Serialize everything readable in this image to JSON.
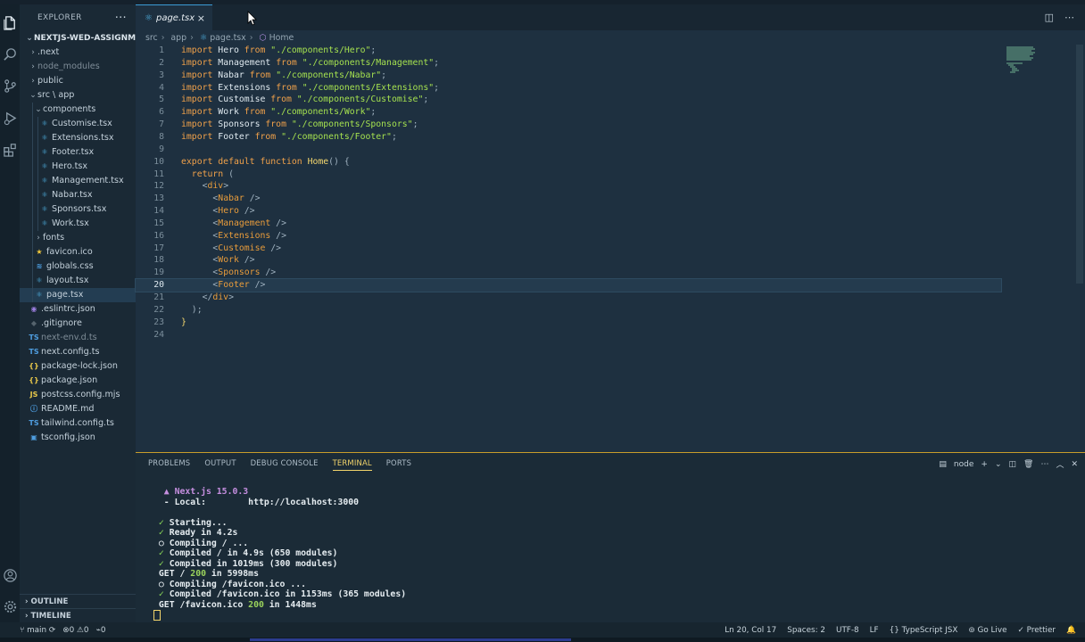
{
  "activity_bar": {
    "top_icons": [
      "explorer-icon",
      "search-icon",
      "source-control-icon",
      "run-debug-icon",
      "extensions-icon"
    ],
    "bottom_icons": [
      "account-icon",
      "settings-gear-icon"
    ]
  },
  "explorer": {
    "title": "EXPLORER",
    "more": "···",
    "project": "NEXTJS-WED-ASSIGNMEN...",
    "tree": [
      {
        "label": ".next",
        "depth": 1,
        "type": "folder",
        "open": false,
        "dim": false,
        "icon": ""
      },
      {
        "label": "node_modules",
        "depth": 1,
        "type": "folder",
        "open": false,
        "dim": true,
        "icon": ""
      },
      {
        "label": "public",
        "depth": 1,
        "type": "folder",
        "open": false,
        "dim": false,
        "icon": ""
      },
      {
        "label": "src \\ app",
        "depth": 1,
        "type": "folder",
        "open": true,
        "dim": false,
        "icon": ""
      },
      {
        "label": "components",
        "depth": 2,
        "type": "folder",
        "open": true,
        "dim": false,
        "icon": ""
      },
      {
        "label": "Customise.tsx",
        "depth": 3,
        "type": "file",
        "icon": "⚛",
        "color": "#4fb0e0"
      },
      {
        "label": "Extensions.tsx",
        "depth": 3,
        "type": "file",
        "icon": "⚛",
        "color": "#4fb0e0"
      },
      {
        "label": "Footer.tsx",
        "depth": 3,
        "type": "file",
        "icon": "⚛",
        "color": "#4fb0e0"
      },
      {
        "label": "Hero.tsx",
        "depth": 3,
        "type": "file",
        "icon": "⚛",
        "color": "#4fb0e0"
      },
      {
        "label": "Management.tsx",
        "depth": 3,
        "type": "file",
        "icon": "⚛",
        "color": "#4fb0e0"
      },
      {
        "label": "Nabar.tsx",
        "depth": 3,
        "type": "file",
        "icon": "⚛",
        "color": "#4fb0e0"
      },
      {
        "label": "Sponsors.tsx",
        "depth": 3,
        "type": "file",
        "icon": "⚛",
        "color": "#4fb0e0"
      },
      {
        "label": "Work.tsx",
        "depth": 3,
        "type": "file",
        "icon": "⚛",
        "color": "#4fb0e0"
      },
      {
        "label": "fonts",
        "depth": 2,
        "type": "folder",
        "open": false,
        "dim": false,
        "icon": ""
      },
      {
        "label": "favicon.ico",
        "depth": 2,
        "type": "file",
        "icon": "★",
        "color": "#f3c93b"
      },
      {
        "label": "globals.css",
        "depth": 2,
        "type": "file",
        "icon": "≋",
        "color": "#4fa3e8"
      },
      {
        "label": "layout.tsx",
        "depth": 2,
        "type": "file",
        "icon": "⚛",
        "color": "#4fb0e0"
      },
      {
        "label": "page.tsx",
        "depth": 2,
        "type": "file",
        "icon": "⚛",
        "color": "#4fb0e0",
        "selected": true
      },
      {
        "label": ".eslintrc.json",
        "depth": 1,
        "type": "file",
        "icon": "◉",
        "color": "#9d7fe0"
      },
      {
        "label": ".gitignore",
        "depth": 1,
        "type": "file",
        "icon": "◆",
        "color": "#55636d"
      },
      {
        "label": "next-env.d.ts",
        "depth": 1,
        "type": "file",
        "icon": "TS",
        "color": "#4f9ee0",
        "dim": true
      },
      {
        "label": "next.config.ts",
        "depth": 1,
        "type": "file",
        "icon": "TS",
        "color": "#4f9ee0"
      },
      {
        "label": "package-lock.json",
        "depth": 1,
        "type": "file",
        "icon": "{}",
        "color": "#e8c84a"
      },
      {
        "label": "package.json",
        "depth": 1,
        "type": "file",
        "icon": "{}",
        "color": "#e8c84a"
      },
      {
        "label": "postcss.config.mjs",
        "depth": 1,
        "type": "file",
        "icon": "JS",
        "color": "#e8c84a"
      },
      {
        "label": "README.md",
        "depth": 1,
        "type": "file",
        "icon": "ⓘ",
        "color": "#4fa3e8"
      },
      {
        "label": "tailwind.config.ts",
        "depth": 1,
        "type": "file",
        "icon": "TS",
        "color": "#4f9ee0"
      },
      {
        "label": "tsconfig.json",
        "depth": 1,
        "type": "file",
        "icon": "▣",
        "color": "#4f9ee0"
      }
    ],
    "outline": "OUTLINE",
    "timeline": "TIMELINE"
  },
  "editor": {
    "tab_label": "page.tsx",
    "tab_close": "×",
    "breadcrumb": [
      "src",
      "app",
      "page.tsx",
      "Home"
    ],
    "active_line": 20,
    "lines": [
      [
        [
          "kw",
          "import "
        ],
        [
          "id",
          "Hero "
        ],
        [
          "kw",
          "from "
        ],
        [
          "str",
          "\"./components/Hero\""
        ],
        [
          "pn",
          ";"
        ]
      ],
      [
        [
          "kw",
          "import "
        ],
        [
          "id",
          "Management "
        ],
        [
          "kw",
          "from "
        ],
        [
          "str",
          "\"./components/Management\""
        ],
        [
          "pn",
          ";"
        ]
      ],
      [
        [
          "kw",
          "import "
        ],
        [
          "id",
          "Nabar "
        ],
        [
          "kw",
          "from "
        ],
        [
          "str",
          "\"./components/Nabar\""
        ],
        [
          "pn",
          ";"
        ]
      ],
      [
        [
          "kw",
          "import "
        ],
        [
          "id",
          "Extensions "
        ],
        [
          "kw",
          "from "
        ],
        [
          "str",
          "\"./components/Extensions\""
        ],
        [
          "pn",
          ";"
        ]
      ],
      [
        [
          "kw",
          "import "
        ],
        [
          "id",
          "Customise "
        ],
        [
          "kw",
          "from "
        ],
        [
          "str",
          "\"./components/Customise\""
        ],
        [
          "pn",
          ";"
        ]
      ],
      [
        [
          "kw",
          "import "
        ],
        [
          "id",
          "Work "
        ],
        [
          "kw",
          "from "
        ],
        [
          "str",
          "\"./components/Work\""
        ],
        [
          "pn",
          ";"
        ]
      ],
      [
        [
          "kw",
          "import "
        ],
        [
          "id",
          "Sponsors "
        ],
        [
          "kw",
          "from "
        ],
        [
          "str",
          "\"./components/Sponsors\""
        ],
        [
          "pn",
          ";"
        ]
      ],
      [
        [
          "kw",
          "import "
        ],
        [
          "id",
          "Footer "
        ],
        [
          "kw",
          "from "
        ],
        [
          "str",
          "\"./components/Footer\""
        ],
        [
          "pn",
          ";"
        ]
      ],
      [],
      [
        [
          "kw",
          "export default function "
        ],
        [
          "fn",
          "Home"
        ],
        [
          "pn",
          "() {"
        ]
      ],
      [
        [
          "id",
          "  "
        ],
        [
          "kw",
          "return "
        ],
        [
          "pn",
          "("
        ]
      ],
      [
        [
          "id",
          "    "
        ],
        [
          "pn",
          "<"
        ],
        [
          "tg",
          "div"
        ],
        [
          "pn",
          ">"
        ]
      ],
      [
        [
          "id",
          "      "
        ],
        [
          "pn",
          "<"
        ],
        [
          "tg",
          "Nabar"
        ],
        [
          "pn",
          " />"
        ]
      ],
      [
        [
          "id",
          "      "
        ],
        [
          "pn",
          "<"
        ],
        [
          "tg",
          "Hero"
        ],
        [
          "pn",
          " />"
        ]
      ],
      [
        [
          "id",
          "      "
        ],
        [
          "pn",
          "<"
        ],
        [
          "tg",
          "Management"
        ],
        [
          "pn",
          " />"
        ]
      ],
      [
        [
          "id",
          "      "
        ],
        [
          "pn",
          "<"
        ],
        [
          "tg",
          "Extensions"
        ],
        [
          "pn",
          " />"
        ]
      ],
      [
        [
          "id",
          "      "
        ],
        [
          "pn",
          "<"
        ],
        [
          "tg",
          "Customise"
        ],
        [
          "pn",
          " />"
        ]
      ],
      [
        [
          "id",
          "      "
        ],
        [
          "pn",
          "<"
        ],
        [
          "tg",
          "Work"
        ],
        [
          "pn",
          " />"
        ]
      ],
      [
        [
          "id",
          "      "
        ],
        [
          "pn",
          "<"
        ],
        [
          "tg",
          "Sponsors"
        ],
        [
          "pn",
          " />"
        ]
      ],
      [
        [
          "id",
          "      "
        ],
        [
          "pn",
          "<"
        ],
        [
          "tg",
          "Footer"
        ],
        [
          "pn",
          " />"
        ]
      ],
      [
        [
          "id",
          "    "
        ],
        [
          "pn",
          "</"
        ],
        [
          "tg",
          "div"
        ],
        [
          "pn",
          ">"
        ]
      ],
      [
        [
          "id",
          "  "
        ],
        [
          "pn",
          ");"
        ]
      ],
      [
        [
          "fn",
          "}"
        ]
      ],
      []
    ]
  },
  "panel": {
    "tabs": [
      "PROBLEMS",
      "OUTPUT",
      "DEBUG CONSOLE",
      "TERMINAL",
      "PORTS"
    ],
    "active_tab": "TERMINAL",
    "shell": "node",
    "terminal": [
      [
        [
          "mag",
          "  ▲ Next.js 15.0.3"
        ]
      ],
      [
        [
          "",
          "  - Local:        http://localhost:3000"
        ]
      ],
      [
        [
          "",
          ""
        ]
      ],
      [
        [
          "g",
          " ✓ "
        ],
        [
          "",
          "Starting..."
        ]
      ],
      [
        [
          "g",
          " ✓ "
        ],
        [
          "",
          "Ready in 4.2s"
        ]
      ],
      [
        [
          "",
          " ○ Compiling / ..."
        ]
      ],
      [
        [
          "g",
          " ✓ "
        ],
        [
          "",
          "Compiled / in 4.9s (650 modules)"
        ]
      ],
      [
        [
          "g",
          " ✓ "
        ],
        [
          "",
          "Compiled in 1019ms (300 modules)"
        ]
      ],
      [
        [
          "",
          " GET / "
        ],
        [
          "sg",
          "200"
        ],
        [
          "",
          " in 5998ms"
        ]
      ],
      [
        [
          "",
          " ○ Compiling /favicon.ico ..."
        ]
      ],
      [
        [
          "g",
          " ✓ "
        ],
        [
          "",
          "Compiled /favicon.ico in 1153ms (365 modules)"
        ]
      ],
      [
        [
          "",
          " GET /favicon.ico "
        ],
        [
          "sg",
          "200"
        ],
        [
          "",
          " in 1448ms"
        ]
      ]
    ]
  },
  "status": {
    "branch": "main",
    "errors": "0",
    "warnings": "0",
    "ports": "0",
    "position": "Ln 20, Col 17",
    "spaces": "Spaces: 2",
    "encoding": "UTF-8",
    "eol": "LF",
    "language": "TypeScript JSX",
    "golive": "Go Live",
    "prettier": "Prettier"
  }
}
